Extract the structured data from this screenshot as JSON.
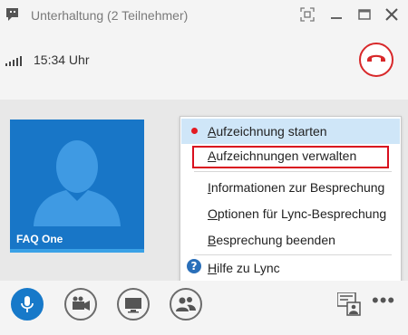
{
  "window": {
    "title": "Unterhaltung (2 Teilnehmer)"
  },
  "status": {
    "time": "15:34 Uhr"
  },
  "participant": {
    "name": "FAQ One"
  },
  "menu": {
    "items": [
      {
        "label": "Aufzeichnung starten",
        "underline": "A",
        "rest": "ufzeichnung starten"
      },
      {
        "label": "Aufzeichnungen verwalten",
        "underline": "A",
        "rest": "ufzeichnungen verwalten"
      },
      {
        "label": "Informationen zur Besprechung",
        "underline": "I",
        "rest": "nformationen zur Besprechung"
      },
      {
        "label": "Optionen für Lync-Besprechung",
        "underline": "O",
        "rest": "ptionen für Lync-Besprechung"
      },
      {
        "label": "Besprechung beenden",
        "underline": "B",
        "rest": "esprechung beenden"
      },
      {
        "label": "Hilfe zu Lync",
        "underline": "H",
        "rest": "ilfe zu Lync"
      }
    ]
  },
  "colors": {
    "accent": "#1779c9",
    "hangup": "#d8282a",
    "record_dot": "#e31b23",
    "highlight_border": "#d90f1f"
  },
  "icons": {
    "app": "lync-conversation-icon",
    "signal": "signal-strength-icon",
    "hangup": "hang-up-icon",
    "mic": "microphone-icon",
    "video": "video-camera-icon",
    "present": "present-screen-icon",
    "people": "participants-icon",
    "content": "content-share-icon",
    "more": "more-options-icon",
    "help": "help-icon"
  }
}
